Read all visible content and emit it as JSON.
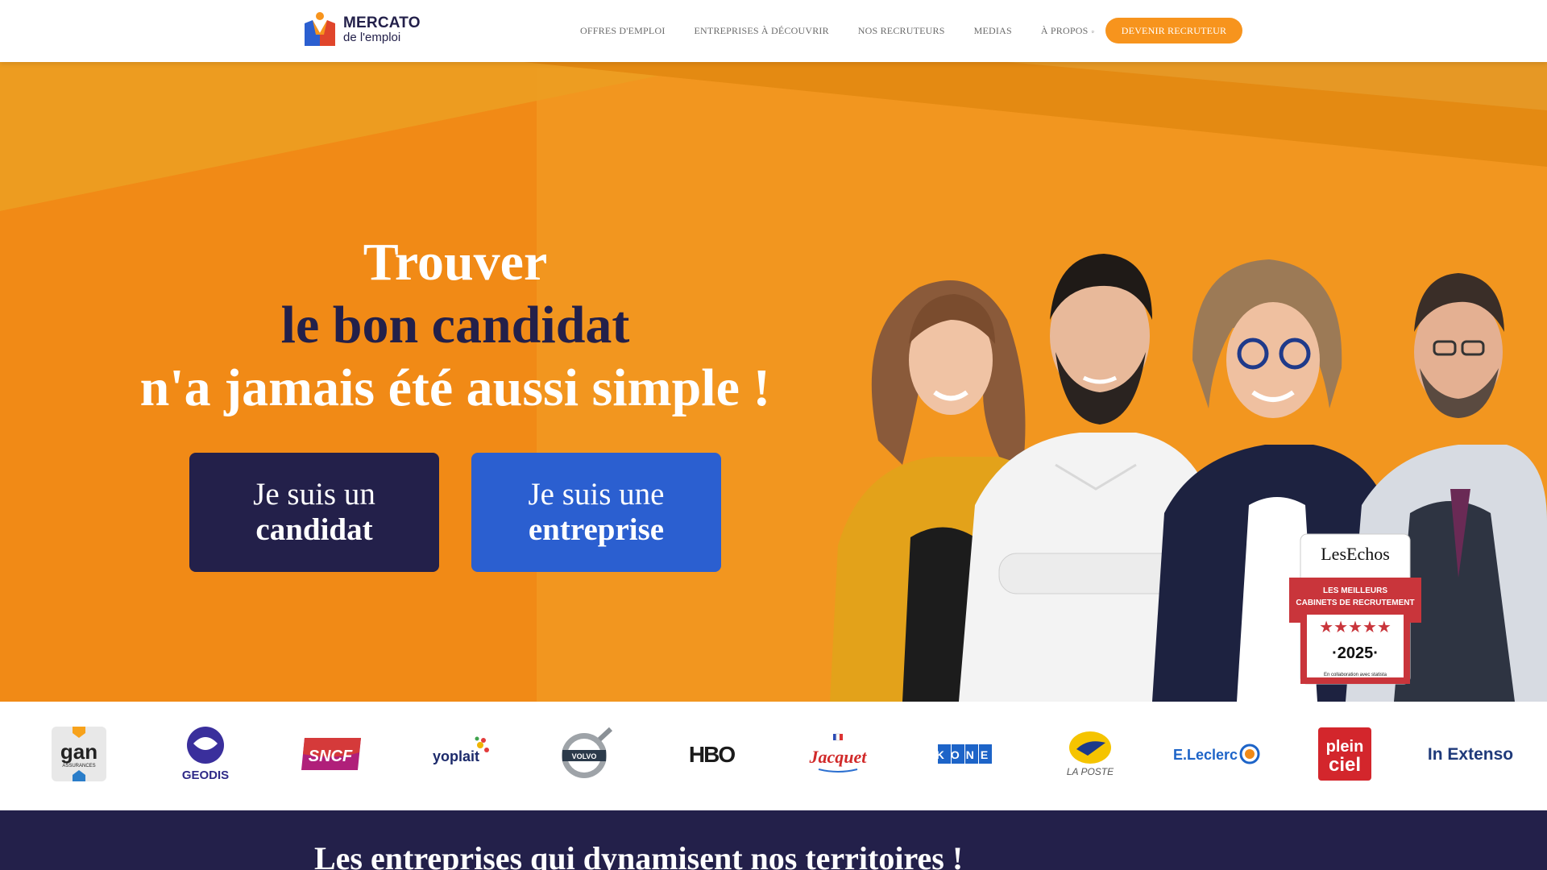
{
  "header": {
    "logo": {
      "line1": "MERCATO",
      "line2": "de l'emploi"
    },
    "nav": [
      {
        "label": "OFFRES D'EMPLOI"
      },
      {
        "label": "ENTREPRISES À DÉCOUVRIR"
      },
      {
        "label": "NOS RECRUTEURS"
      },
      {
        "label": "MEDIAS"
      },
      {
        "label": "À PROPOS"
      }
    ],
    "cta_label": "DEVENIR RECRUTEUR"
  },
  "hero": {
    "title_line1": "Trouver",
    "title_line2": "le bon candidat",
    "title_line3": "n'a jamais été aussi simple !",
    "candidate_button": {
      "line1": "Je suis un",
      "line2": "candidat"
    },
    "company_button": {
      "line1": "Je suis une",
      "line2": "entreprise"
    }
  },
  "badge": {
    "brand": "LesEchos",
    "line1": "LES MEILLEURS",
    "line2": "CABINETS DE RECRUTEMENT",
    "stars": 5,
    "year": "·2025·",
    "footer": "En collaboration avec  statista"
  },
  "partners": [
    {
      "name": "gan",
      "sub": "ASSURANCES"
    },
    {
      "name": "GEODIS"
    },
    {
      "name": "SNCF"
    },
    {
      "name": "yoplait"
    },
    {
      "name": "VOLVO"
    },
    {
      "name": "HBO"
    },
    {
      "name": "Jacquet"
    },
    {
      "name": "KONE"
    },
    {
      "name": "LA POSTE"
    },
    {
      "name": "E.Leclerc"
    },
    {
      "name": "plein ciel"
    },
    {
      "name": "In Extenso"
    }
  ],
  "band": {
    "title": "Les entreprises qui dynamisent nos territoires !"
  },
  "colors": {
    "orange": "#f7941d",
    "navy": "#23204a",
    "blue": "#2b5fd0"
  }
}
